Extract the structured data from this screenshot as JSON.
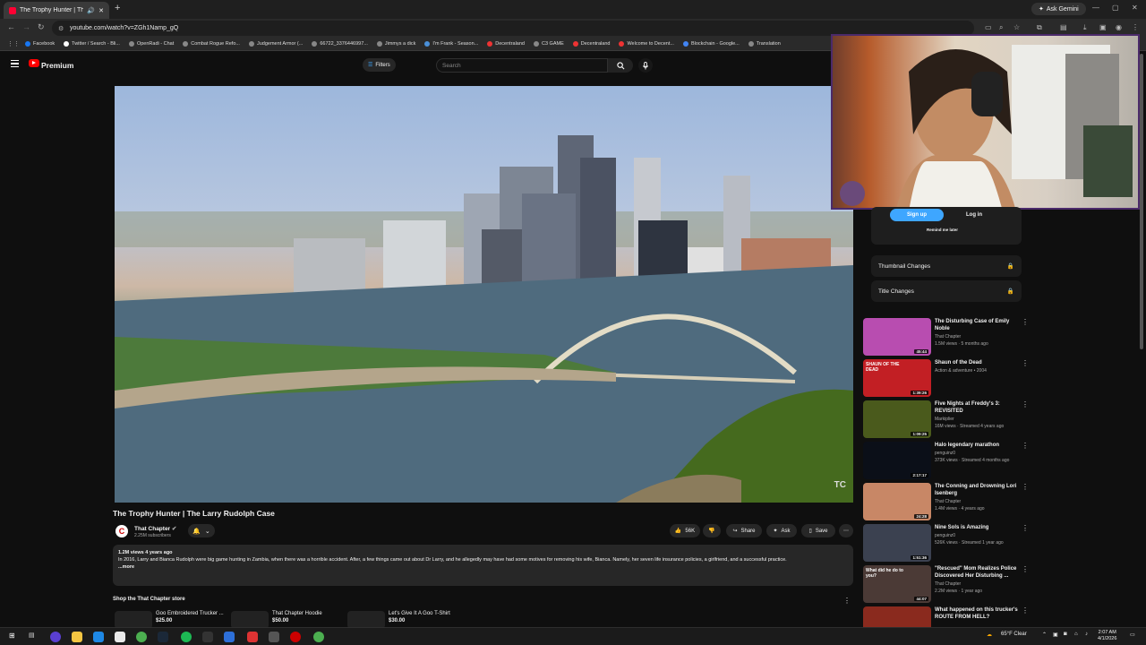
{
  "browser": {
    "tab_title": "The Trophy Hunter | The La",
    "url": "youtube.com/watch?v=ZGh1Namp_gQ",
    "gemini_label": "Ask Gemini",
    "bookmarks": [
      "Facebook",
      "Twitter / Search - Bli...",
      "OpenRadi - Chat",
      "Combat Rogue Refo...",
      "Judgement Armor (...",
      "66722_3376446997...",
      "Jimmys a dick",
      "I'm Frank - Season...",
      "Decentraland",
      "C3 GAME",
      "Decentraland",
      "Welcome to Decent...",
      "Blockchain - Google...",
      "Translation"
    ]
  },
  "youtube": {
    "brand": "Premium",
    "filters_label": "Filters",
    "search_placeholder": "Search"
  },
  "video": {
    "watermark": "TC",
    "title": "The Trophy Hunter | The Larry Rudolph Case",
    "channel": "That Chapter",
    "channel_initial": "C",
    "subscribers": "2.25M subscribers",
    "likes": "56K",
    "share_label": "Share",
    "ask_label": "Ask",
    "save_label": "Save",
    "meta": "1.2M views  4 years ago",
    "description": "In 2016, Larry and Bianca Rudolph were big game hunting in Zambia, when there was a horrible accident. After, a few things came out about Dr Larry, and he allegedly may have had some motives for removing his wife, Bianca. Namely, her seven life insurance policies, a girlfriend, and a successful practice.",
    "more_label": "...more"
  },
  "store": {
    "heading": "Shop the That Chapter store",
    "items": [
      {
        "name": "Goo Embroidered Trucker ...",
        "price": "$25.00"
      },
      {
        "name": "That Chapter Hoodie",
        "price": "$50.00"
      },
      {
        "name": "Let's Give It A Goo T-Shirt",
        "price": "$30.00"
      }
    ]
  },
  "sidepanel": {
    "signup_label": "Sign up",
    "login_label": "Log in",
    "remind_label": "Remind me later",
    "locked_rows": [
      "Thumbnail Changes",
      "Title Changes"
    ]
  },
  "recommendations": [
    {
      "title": "The Disturbing Case of Emily Noble",
      "channel": "That Chapter",
      "meta": "1.5M views · 5 months ago",
      "duration": "45:44",
      "color": "#b84db0"
    },
    {
      "title": "Shaun of the Dead",
      "channel": "Action & adventure • 2004",
      "meta": "",
      "duration": "1:39:26",
      "color": "#c21f24",
      "overlay": "SHAUN OF THE DEAD"
    },
    {
      "title": "Five Nights at Freddy's 3: REVISITED",
      "channel": "Markiplier",
      "meta": "16M views · Streamed 4 years ago",
      "duration": "1:09:25",
      "color": "#4a5a1c"
    },
    {
      "title": "Halo legendary marathon",
      "channel": "penguinz0",
      "meta": "373K views · Streamed 4 months ago",
      "duration": "2:17:17",
      "color": "#0b0f18"
    },
    {
      "title": "The Conning and Drowning Lori Isenberg",
      "channel": "That Chapter",
      "meta": "1.4M views · 4 years ago",
      "duration": "24:28",
      "color": "#c88766"
    },
    {
      "title": "Nine Sols is Amazing",
      "channel": "penguinz0",
      "meta": "526K views · Streamed 1 year ago",
      "duration": "1:51:36",
      "color": "#3b4150"
    },
    {
      "title": "\"Rescued\" Mom Realizes Police Discovered Her Disturbing ...",
      "channel": "That Chapter",
      "meta": "2.2M views · 1 year ago",
      "duration": "44:07",
      "color": "#4b3a36",
      "overlay": "What did he do to you?"
    },
    {
      "title": "What happened on this trucker's ROUTE FROM HELL?",
      "channel": "",
      "meta": "",
      "duration": "",
      "color": "#8a2a1e"
    }
  ],
  "taskbar": {
    "weather": "65°F  Clear",
    "time": "2:07 AM",
    "date": "4/1/2026"
  }
}
